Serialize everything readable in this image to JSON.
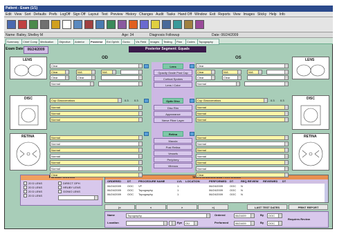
{
  "window": {
    "title": "Patient - Exam (1/1)"
  },
  "menu": [
    "Edit",
    "View",
    "Sort",
    "Defaults",
    "Prefs",
    "LogOff",
    "Sign Off",
    "Layout",
    "Text",
    "Preview",
    "History",
    "Changes",
    "Audit",
    "Tasks",
    "Hand Off",
    "Window",
    "Exit",
    "Reports",
    "View",
    "Images",
    "Sticky",
    "Help",
    "Info"
  ],
  "toolbar_icons": [
    {
      "name": "print-icon",
      "color": "#4a6ab0"
    },
    {
      "name": "chart-icon",
      "color": "#c04040"
    },
    {
      "name": "grid-icon",
      "color": "#4a8a4a"
    },
    {
      "name": "table-icon",
      "color": "#707070"
    },
    {
      "name": "calendar-icon",
      "color": "#d0a020"
    },
    {
      "name": "document-icon",
      "color": "#ffffff"
    },
    {
      "name": "building-icon",
      "color": "#5a8ac0"
    },
    {
      "name": "people-icon",
      "color": "#a04040"
    },
    {
      "name": "image-icon",
      "color": "#4a7ab0"
    },
    {
      "name": "eye-icon",
      "color": "#3a8a5a"
    },
    {
      "name": "pen-icon",
      "color": "#8a5aa0"
    },
    {
      "name": "warning-icon",
      "color": "#e06020"
    },
    {
      "name": "cards-icon",
      "color": "#6a6ad0"
    },
    {
      "name": "note-icon",
      "color": "#e0d040"
    },
    {
      "name": "monitor-icon",
      "color": "#4a6a9a"
    },
    {
      "name": "scan-icon",
      "color": "#3a9a9a"
    },
    {
      "name": "tools-icon",
      "color": "#a08040"
    },
    {
      "name": "settings-icon",
      "color": "#9a4a9a"
    }
  ],
  "patient": {
    "name": "Name: Bailey, Shelley M",
    "age": "Age: 34",
    "type": "Diagnosis Followup",
    "date": "Date: 06/24/2009"
  },
  "tabs": [
    "Summary",
    "Chief Comp",
    "Medication",
    "Objective",
    "Anterior",
    "Posterior",
    "Ext Ophth",
    "Gonio",
    "Vis Field",
    "Images",
    "Testing",
    "Plan",
    "Codes",
    "Topography"
  ],
  "active_tab": 5,
  "exam": {
    "label": "Exam Date:",
    "date": "06/24/2009",
    "title": "Posterior Segment: Equals"
  },
  "headers": {
    "od": "OD",
    "os": "OS",
    "lens_l": "LENS",
    "lens_r": "LENS",
    "disc_l": "DISC",
    "disc_r": "DISC",
    "retina_l": "RETINA",
    "retina_r": "RETINA"
  },
  "od": {
    "lens_row1": "Clear",
    "lens_rows": [
      [
        "Clear",
        "N/A",
        "N/A"
      ],
      [
        "Clear",
        "Clear",
        ""
      ],
      [
        "Normal",
        ""
      ]
    ],
    "cup": "Cup Glaucomatous",
    "cd1": "0.3",
    "cd2": "0.3",
    "disc_rows": [
      "Normal",
      "Normal",
      "Normal"
    ],
    "retina_rows": [
      "Normal",
      "Normal",
      "Normal",
      "Normal",
      "Normal",
      "Normal",
      "Clear"
    ]
  },
  "os": {
    "lens_row1": "Clear",
    "lens_rows": [
      [
        "Clear",
        "N/A",
        "N/A"
      ],
      [
        "Clear",
        "Clear",
        ""
      ],
      [
        "Normal",
        ""
      ]
    ],
    "cup": "Cup Glaucomatous",
    "cd1": "0.3",
    "cd2": "0.3",
    "disc_rows": [
      "Normal",
      "Normal",
      "Normal"
    ],
    "retina_rows": [
      "Normal",
      "Normal",
      "Normal",
      "Normal",
      "Normal",
      "Normal",
      "Clear"
    ]
  },
  "center": {
    "lens_header": "Lens",
    "lens_items": [
      "Opacity Grade Post Cap",
      "Cortical Spokes",
      "Lens / Color"
    ],
    "disc_header": "Optic Disc",
    "disc_items": [
      "Disc Rim",
      "Appearance",
      "Nerve Fiber Layer"
    ],
    "retina_header": "Retina",
    "retina_items": [
      "Macula",
      "Post Retina",
      "Vessels",
      "Periphery",
      "Vitreous"
    ]
  },
  "fundus": {
    "title": "Fundus Method",
    "left": [
      "20 D LENS",
      "20 D LENS",
      "20 D LENS",
      "20 D LENS"
    ],
    "right": [
      "DIRECT OPH",
      "HRUBY LENS",
      "GONIO LENS"
    ]
  },
  "tests": {
    "title": "TESTS ORDERED AND PERFORMED",
    "columns": [
      "ORDERED",
      "DT",
      "PROCEDURE NAME",
      "LVL",
      "LOCATION",
      "PERFORMED",
      "DT",
      "REQ REVIEW",
      "REVIEWED",
      "DT"
    ],
    "rows": [
      [
        "06/24/2009",
        "OOC",
        "VF",
        "1",
        "",
        "06/24/2009",
        "OOC",
        "N",
        "",
        ""
      ],
      [
        "06/24/2009",
        "OOC",
        "Topography",
        "1",
        "",
        "06/24/2009",
        "OOC",
        "N",
        "",
        ""
      ],
      [
        "06/24/2009",
        "OOC",
        "Topography",
        "1",
        "",
        "06/24/2009",
        "OOC",
        "N",
        "",
        ""
      ]
    ]
  },
  "nav": {
    "first": "|<",
    "prev": "<",
    "next": ">",
    "last": ">|",
    "last_test": "LAST TEST DATES",
    "print": "PRINT REPORT"
  },
  "form": {
    "name_label": "Name",
    "name_value": "Topography",
    "location_label": "Location",
    "eye_label": "Eye",
    "eye_value": "OU",
    "ordered_label": "Ordered",
    "ordered_date": "06/24/09",
    "by_label1": "By",
    "by_value1": "OOC",
    "performed_label": "Performed",
    "performed_date": "06/24/09",
    "by_label2": "By",
    "by_value2": "OOC",
    "review": "Requires Review"
  }
}
